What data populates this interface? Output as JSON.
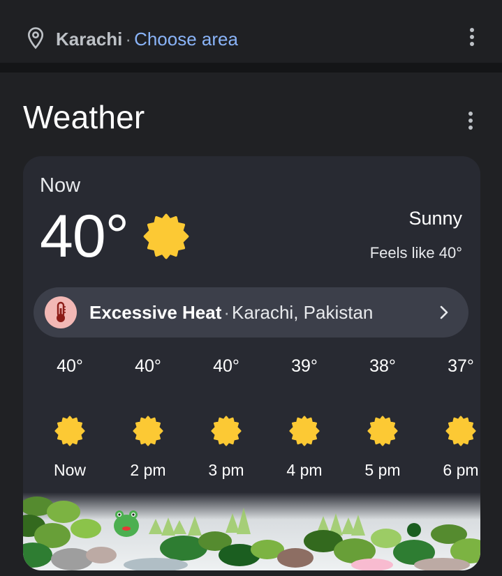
{
  "location_bar": {
    "city": "Karachi",
    "separator": "·",
    "choose_area": "Choose area"
  },
  "weather": {
    "title": "Weather",
    "now_label": "Now",
    "temperature": "40°",
    "condition": "Sunny",
    "feels_like": "Feels like 40°",
    "current_icon": "sun-icon"
  },
  "alert": {
    "title": "Excessive Heat",
    "separator": "·",
    "location": "Karachi, Pakistan",
    "icon": "thermometer-icon"
  },
  "hourly": [
    {
      "temp": "40°",
      "time": "Now",
      "icon": "sun-icon"
    },
    {
      "temp": "40°",
      "time": "2 pm",
      "icon": "sun-icon"
    },
    {
      "temp": "40°",
      "time": "3 pm",
      "icon": "sun-icon"
    },
    {
      "temp": "39°",
      "time": "4 pm",
      "icon": "sun-icon"
    },
    {
      "temp": "38°",
      "time": "5 pm",
      "icon": "sun-icon"
    },
    {
      "temp": "37°",
      "time": "6 pm",
      "icon": "sun-icon"
    }
  ],
  "colors": {
    "background": "#202124",
    "card": "#282a32",
    "accent_link": "#8ab4f8",
    "sun": "#fcc934",
    "alert_badge": "#f2b8b5"
  }
}
